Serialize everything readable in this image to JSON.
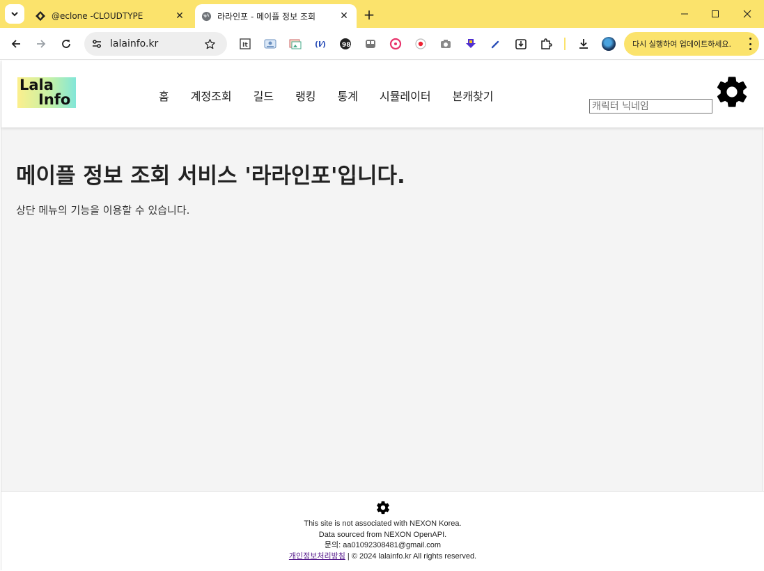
{
  "browser": {
    "tabs": [
      {
        "title": "@eclone -CLOUDTYPE",
        "icon": "cloudtype-icon"
      },
      {
        "title": "라라인포 - 메이플 정보 조회",
        "icon": "globe-icon",
        "active": true
      }
    ],
    "url": "lalainfo.kr",
    "update_message": "다시 실행하여 업데이트하세요."
  },
  "site": {
    "logo": {
      "line1": "Lala",
      "line2": "Info"
    },
    "nav": [
      "홈",
      "계정조회",
      "길드",
      "랭킹",
      "통계",
      "시뮬레이터",
      "본캐찾기"
    ],
    "search": {
      "placeholder": "캐릭터 닉네임",
      "value": ""
    }
  },
  "main": {
    "title": "메이플 정보 조회 서비스 '라라인포'입니다.",
    "description": "상단 메뉴의 기능을 이용할 수 있습니다."
  },
  "footer": {
    "line1": "This site is not associated with NEXON Korea.",
    "line2": "Data sourced from NEXON OpenAPI.",
    "contact": "문의: aa01092308481@gmail.com",
    "privacy_link": "개인정보처리방침",
    "copyright": " | © 2024 lalainfo.kr All rights reserved."
  },
  "colors": {
    "tabstrip": "#fbe36c",
    "page_background": "#f4f4f4",
    "text": "#222222"
  }
}
